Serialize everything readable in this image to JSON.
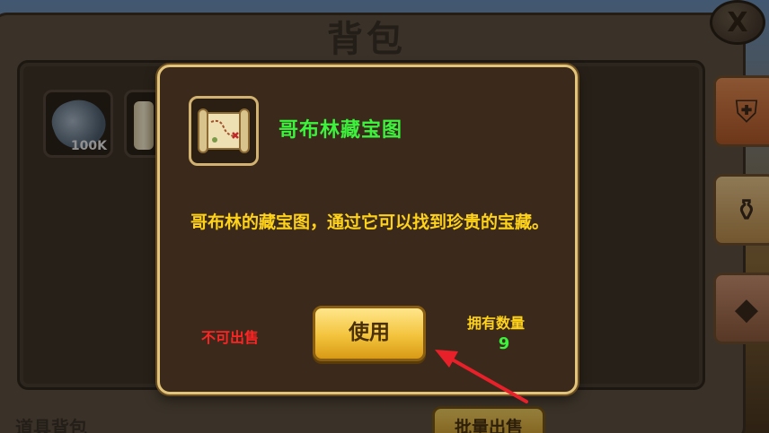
{
  "background": {
    "bag_title": "背包",
    "close_glyph": "X",
    "slots": [
      {
        "icon": "stone-icon",
        "quantity": "100K"
      },
      {
        "icon": "scroll-icon",
        "quantity": ""
      }
    ],
    "bag_label": "道具背包",
    "batch_sell_label": "批量出售",
    "side_tabs": [
      {
        "icon": "armor-icon",
        "glyph": "⛨"
      },
      {
        "icon": "urn-icon",
        "glyph": "⚱"
      },
      {
        "icon": "gem-icon",
        "glyph": "◆"
      }
    ]
  },
  "popup": {
    "item_icon": "treasure-map-icon",
    "item_name": "哥布林藏宝图",
    "description": "哥布林的藏宝图，通过它可以找到珍贵的宝藏。",
    "not_sellable": "不可出售",
    "use_label": "使用",
    "owned_label": "拥有数量",
    "owned_count": "9"
  },
  "colors": {
    "name_green": "#3cf23c",
    "desc_yellow": "#ffd21a",
    "warn_red": "#ff2424",
    "popup_border": "#e1c47a",
    "arrow_red": "#e8202a"
  }
}
